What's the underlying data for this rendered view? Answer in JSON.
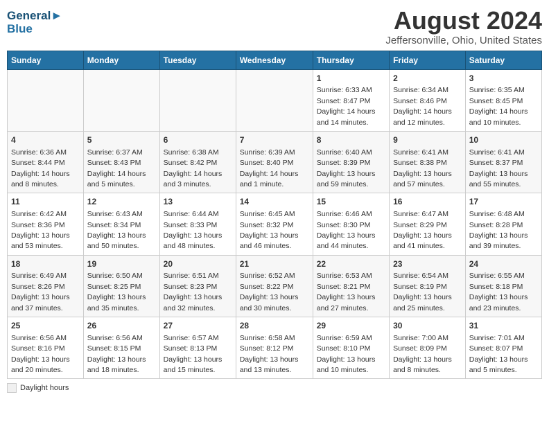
{
  "header": {
    "logo_line1": "General",
    "logo_line2": "Blue",
    "month": "August 2024",
    "location": "Jeffersonville, Ohio, United States"
  },
  "days_of_week": [
    "Sunday",
    "Monday",
    "Tuesday",
    "Wednesday",
    "Thursday",
    "Friday",
    "Saturday"
  ],
  "legend": {
    "label": "Daylight hours"
  },
  "weeks": [
    [
      {
        "day": "",
        "sunrise": "",
        "sunset": "",
        "daylight": "",
        "empty": true
      },
      {
        "day": "",
        "sunrise": "",
        "sunset": "",
        "daylight": "",
        "empty": true
      },
      {
        "day": "",
        "sunrise": "",
        "sunset": "",
        "daylight": "",
        "empty": true
      },
      {
        "day": "",
        "sunrise": "",
        "sunset": "",
        "daylight": "",
        "empty": true
      },
      {
        "day": "1",
        "sunrise": "Sunrise: 6:33 AM",
        "sunset": "Sunset: 8:47 PM",
        "daylight": "Daylight: 14 hours and 14 minutes.",
        "empty": false
      },
      {
        "day": "2",
        "sunrise": "Sunrise: 6:34 AM",
        "sunset": "Sunset: 8:46 PM",
        "daylight": "Daylight: 14 hours and 12 minutes.",
        "empty": false
      },
      {
        "day": "3",
        "sunrise": "Sunrise: 6:35 AM",
        "sunset": "Sunset: 8:45 PM",
        "daylight": "Daylight: 14 hours and 10 minutes.",
        "empty": false
      }
    ],
    [
      {
        "day": "4",
        "sunrise": "Sunrise: 6:36 AM",
        "sunset": "Sunset: 8:44 PM",
        "daylight": "Daylight: 14 hours and 8 minutes.",
        "empty": false
      },
      {
        "day": "5",
        "sunrise": "Sunrise: 6:37 AM",
        "sunset": "Sunset: 8:43 PM",
        "daylight": "Daylight: 14 hours and 5 minutes.",
        "empty": false
      },
      {
        "day": "6",
        "sunrise": "Sunrise: 6:38 AM",
        "sunset": "Sunset: 8:42 PM",
        "daylight": "Daylight: 14 hours and 3 minutes.",
        "empty": false
      },
      {
        "day": "7",
        "sunrise": "Sunrise: 6:39 AM",
        "sunset": "Sunset: 8:40 PM",
        "daylight": "Daylight: 14 hours and 1 minute.",
        "empty": false
      },
      {
        "day": "8",
        "sunrise": "Sunrise: 6:40 AM",
        "sunset": "Sunset: 8:39 PM",
        "daylight": "Daylight: 13 hours and 59 minutes.",
        "empty": false
      },
      {
        "day": "9",
        "sunrise": "Sunrise: 6:41 AM",
        "sunset": "Sunset: 8:38 PM",
        "daylight": "Daylight: 13 hours and 57 minutes.",
        "empty": false
      },
      {
        "day": "10",
        "sunrise": "Sunrise: 6:41 AM",
        "sunset": "Sunset: 8:37 PM",
        "daylight": "Daylight: 13 hours and 55 minutes.",
        "empty": false
      }
    ],
    [
      {
        "day": "11",
        "sunrise": "Sunrise: 6:42 AM",
        "sunset": "Sunset: 8:36 PM",
        "daylight": "Daylight: 13 hours and 53 minutes.",
        "empty": false
      },
      {
        "day": "12",
        "sunrise": "Sunrise: 6:43 AM",
        "sunset": "Sunset: 8:34 PM",
        "daylight": "Daylight: 13 hours and 50 minutes.",
        "empty": false
      },
      {
        "day": "13",
        "sunrise": "Sunrise: 6:44 AM",
        "sunset": "Sunset: 8:33 PM",
        "daylight": "Daylight: 13 hours and 48 minutes.",
        "empty": false
      },
      {
        "day": "14",
        "sunrise": "Sunrise: 6:45 AM",
        "sunset": "Sunset: 8:32 PM",
        "daylight": "Daylight: 13 hours and 46 minutes.",
        "empty": false
      },
      {
        "day": "15",
        "sunrise": "Sunrise: 6:46 AM",
        "sunset": "Sunset: 8:30 PM",
        "daylight": "Daylight: 13 hours and 44 minutes.",
        "empty": false
      },
      {
        "day": "16",
        "sunrise": "Sunrise: 6:47 AM",
        "sunset": "Sunset: 8:29 PM",
        "daylight": "Daylight: 13 hours and 41 minutes.",
        "empty": false
      },
      {
        "day": "17",
        "sunrise": "Sunrise: 6:48 AM",
        "sunset": "Sunset: 8:28 PM",
        "daylight": "Daylight: 13 hours and 39 minutes.",
        "empty": false
      }
    ],
    [
      {
        "day": "18",
        "sunrise": "Sunrise: 6:49 AM",
        "sunset": "Sunset: 8:26 PM",
        "daylight": "Daylight: 13 hours and 37 minutes.",
        "empty": false
      },
      {
        "day": "19",
        "sunrise": "Sunrise: 6:50 AM",
        "sunset": "Sunset: 8:25 PM",
        "daylight": "Daylight: 13 hours and 35 minutes.",
        "empty": false
      },
      {
        "day": "20",
        "sunrise": "Sunrise: 6:51 AM",
        "sunset": "Sunset: 8:23 PM",
        "daylight": "Daylight: 13 hours and 32 minutes.",
        "empty": false
      },
      {
        "day": "21",
        "sunrise": "Sunrise: 6:52 AM",
        "sunset": "Sunset: 8:22 PM",
        "daylight": "Daylight: 13 hours and 30 minutes.",
        "empty": false
      },
      {
        "day": "22",
        "sunrise": "Sunrise: 6:53 AM",
        "sunset": "Sunset: 8:21 PM",
        "daylight": "Daylight: 13 hours and 27 minutes.",
        "empty": false
      },
      {
        "day": "23",
        "sunrise": "Sunrise: 6:54 AM",
        "sunset": "Sunset: 8:19 PM",
        "daylight": "Daylight: 13 hours and 25 minutes.",
        "empty": false
      },
      {
        "day": "24",
        "sunrise": "Sunrise: 6:55 AM",
        "sunset": "Sunset: 8:18 PM",
        "daylight": "Daylight: 13 hours and 23 minutes.",
        "empty": false
      }
    ],
    [
      {
        "day": "25",
        "sunrise": "Sunrise: 6:56 AM",
        "sunset": "Sunset: 8:16 PM",
        "daylight": "Daylight: 13 hours and 20 minutes.",
        "empty": false
      },
      {
        "day": "26",
        "sunrise": "Sunrise: 6:56 AM",
        "sunset": "Sunset: 8:15 PM",
        "daylight": "Daylight: 13 hours and 18 minutes.",
        "empty": false
      },
      {
        "day": "27",
        "sunrise": "Sunrise: 6:57 AM",
        "sunset": "Sunset: 8:13 PM",
        "daylight": "Daylight: 13 hours and 15 minutes.",
        "empty": false
      },
      {
        "day": "28",
        "sunrise": "Sunrise: 6:58 AM",
        "sunset": "Sunset: 8:12 PM",
        "daylight": "Daylight: 13 hours and 13 minutes.",
        "empty": false
      },
      {
        "day": "29",
        "sunrise": "Sunrise: 6:59 AM",
        "sunset": "Sunset: 8:10 PM",
        "daylight": "Daylight: 13 hours and 10 minutes.",
        "empty": false
      },
      {
        "day": "30",
        "sunrise": "Sunrise: 7:00 AM",
        "sunset": "Sunset: 8:09 PM",
        "daylight": "Daylight: 13 hours and 8 minutes.",
        "empty": false
      },
      {
        "day": "31",
        "sunrise": "Sunrise: 7:01 AM",
        "sunset": "Sunset: 8:07 PM",
        "daylight": "Daylight: 13 hours and 5 minutes.",
        "empty": false
      }
    ]
  ]
}
